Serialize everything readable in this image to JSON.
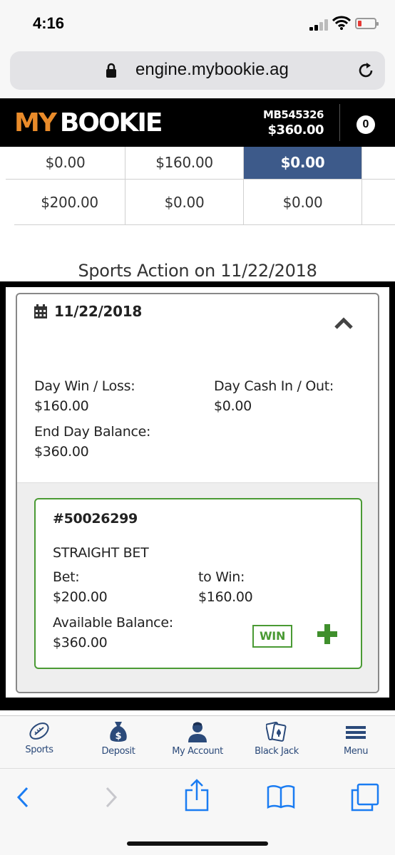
{
  "status_bar": {
    "time": "4:16"
  },
  "browser": {
    "url": "engine.mybookie.ag"
  },
  "header": {
    "logo_my": "MY",
    "logo_bookie": "BOOKIE",
    "account_id": "MB545326",
    "balance": "$360.00",
    "bet_count": "0"
  },
  "summary_table": {
    "rows": [
      [
        "$0.00",
        "$160.00",
        "$0.00"
      ],
      [
        "$200.00",
        "$0.00",
        "$0.00"
      ]
    ]
  },
  "section_title": "Sports Action on 11/22/2018",
  "day": {
    "date": "11/22/2018",
    "win_loss_label": "Day Win / Loss:",
    "win_loss_value": "$160.00",
    "cash_label": "Day Cash In / Out:",
    "cash_value": "$0.00",
    "end_balance_label": "End Day Balance:",
    "end_balance_value": "$360.00"
  },
  "bet": {
    "id": "#50026299",
    "type": "STRAIGHT BET",
    "bet_label": "Bet:",
    "bet_value": "$200.00",
    "to_win_label": "to Win:",
    "to_win_value": "$160.00",
    "available_label": "Available Balance:",
    "available_value": "$360.00",
    "result": "WIN"
  },
  "bottom_nav": {
    "items": [
      {
        "label": "Sports",
        "icon": "football-icon"
      },
      {
        "label": "Deposit",
        "icon": "money-bag-icon"
      },
      {
        "label": "My Account",
        "icon": "user-icon"
      },
      {
        "label": "Black Jack",
        "icon": "cards-icon"
      },
      {
        "label": "Menu",
        "icon": "hamburger-icon"
      }
    ]
  },
  "colors": {
    "brand_orange": "#e98b2a",
    "header_bg": "#000000",
    "active_cell": "#3d5a8a",
    "win_green": "#4a9a34",
    "nav_blue": "#2b4a7a",
    "ios_blue": "#1a7cf2"
  }
}
